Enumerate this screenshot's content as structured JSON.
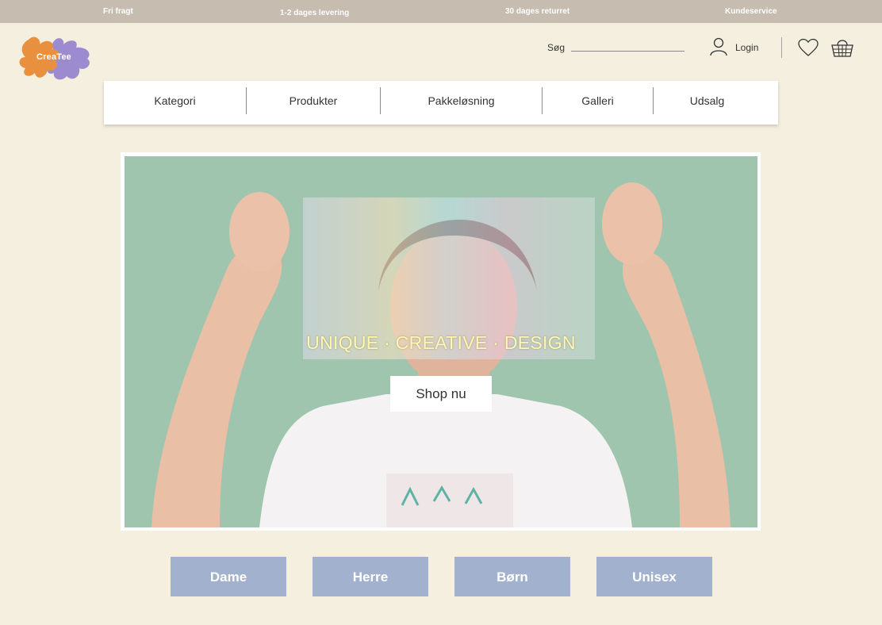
{
  "topbar": {
    "free_shipping": "Fri fragt",
    "delivery": "1-2 dages levering",
    "returns": "30 dages returret",
    "customer_service": "Kundeservice"
  },
  "logo": {
    "text": "CreaTee"
  },
  "header": {
    "search_label": "Søg",
    "search_value": "",
    "login_label": "Login"
  },
  "nav": {
    "items": [
      {
        "label": "Kategori"
      },
      {
        "label": "Produkter"
      },
      {
        "label": "Pakkeløsning"
      },
      {
        "label": "Galleri"
      },
      {
        "label": "Udsalg"
      }
    ]
  },
  "hero": {
    "tagline": "UNIQUE · CREATIVE · DESIGN",
    "cta_label": "Shop nu"
  },
  "categories": [
    {
      "label": "Dame"
    },
    {
      "label": "Herre"
    },
    {
      "label": "Børn"
    },
    {
      "label": "Unisex"
    }
  ],
  "colors": {
    "background": "#f5efdf",
    "topbar": "#c6bcb0",
    "category_button": "#a2b1cd",
    "hero_background": "#9fc5ae",
    "logo_orange": "#e8903e",
    "logo_purple": "#9c8ccf"
  },
  "icons": {
    "login": "user-icon",
    "wishlist": "heart-icon",
    "cart": "basket-icon"
  }
}
